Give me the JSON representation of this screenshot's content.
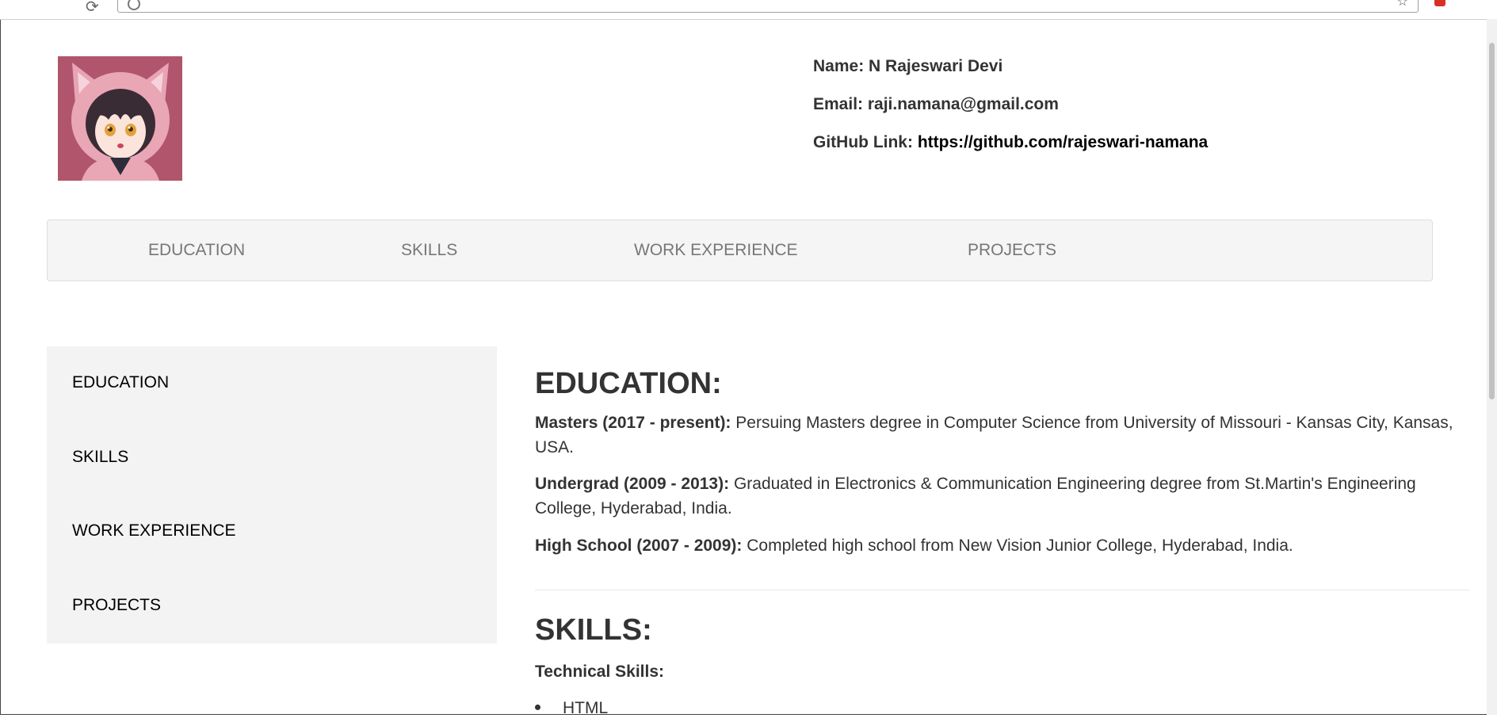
{
  "profile": {
    "name_label": "Name:",
    "name_value": "N Rajeswari Devi",
    "email_label": "Email:",
    "email_value": "raji.namana@gmail.com",
    "github_label": "GitHub Link:",
    "github_value": "https://github.com/rajeswari-namana"
  },
  "topnav": [
    "EDUCATION",
    "SKILLS",
    "WORK EXPERIENCE",
    "PROJECTS"
  ],
  "sidebar": [
    "EDUCATION",
    "SKILLS",
    "WORK EXPERIENCE",
    "PROJECTS"
  ],
  "education": {
    "title": "EDUCATION:",
    "entries": [
      {
        "label": "Masters (2017 - present):",
        "text": "Persuing Masters degree in Computer Science from University of Missouri - Kansas City, Kansas, USA."
      },
      {
        "label": "Undergrad (2009 - 2013):",
        "text": "Graduated in Electronics & Communication Engineering degree from St.Martin's Engineering College, Hyderabad, India."
      },
      {
        "label": "High School (2007 - 2009):",
        "text": "Completed high school from New Vision Junior College, Hyderabad, India."
      }
    ]
  },
  "skills": {
    "title": "SKILLS:",
    "subtitle": "Technical Skills:",
    "items": [
      "HTML"
    ]
  },
  "colors": {
    "nav_bg": "#f5f5f5",
    "sidebar_bg": "#f3f3f3",
    "nav_text": "#777777",
    "avatar_bg": "#b0556c"
  },
  "icons": {
    "avatar": "anime-avatar-image",
    "reload": "reload-icon",
    "star": "bookmark-star-icon"
  }
}
